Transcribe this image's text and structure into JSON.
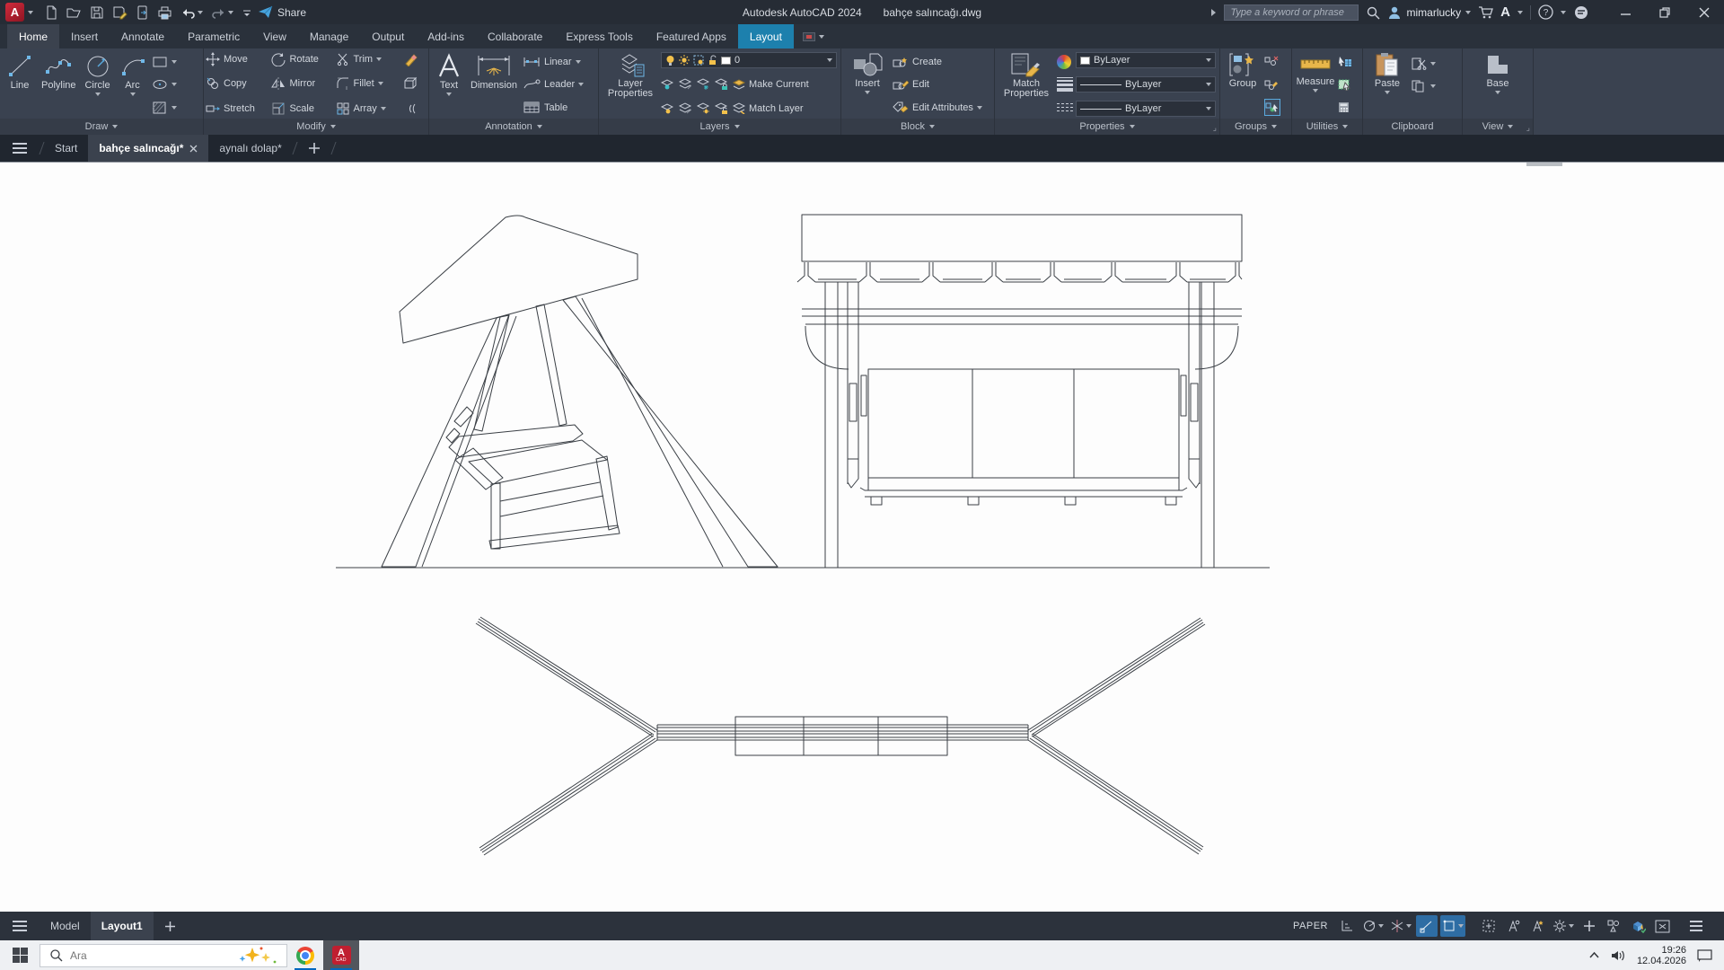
{
  "colors": {
    "layout_tab_blue": "#1d80ad",
    "snap_active_blue": "#2e6da4",
    "canvas_stroke": "#3a3f45",
    "accent_yellow": "#e9b23c",
    "accent_blue": "#5aa9dd"
  },
  "titlebar": {
    "app_badge": "A",
    "app_title": "Autodesk AutoCAD 2024",
    "doc_title": "bahçe salıncağı.dwg",
    "share_label": "Share",
    "search_placeholder": "Type a keyword or phrase",
    "user_name": "mimarlucky",
    "autodesk_logo": "A"
  },
  "ribbon": {
    "tabs": [
      "Home",
      "Insert",
      "Annotate",
      "Parametric",
      "View",
      "Manage",
      "Output",
      "Add-ins",
      "Collaborate",
      "Express Tools",
      "Featured Apps",
      "Layout"
    ],
    "panels": {
      "draw": {
        "title": "Draw",
        "line": "Line",
        "polyline": "Polyline",
        "circle": "Circle",
        "arc": "Arc"
      },
      "modify": {
        "title": "Modify",
        "move": "Move",
        "rotate": "Rotate",
        "trim": "Trim",
        "copy": "Copy",
        "mirror": "Mirror",
        "fillet": "Fillet",
        "stretch": "Stretch",
        "scale": "Scale",
        "array": "Array"
      },
      "annotation": {
        "title": "Annotation",
        "text": "Text",
        "dimension": "Dimension",
        "linear": "Linear",
        "leader": "Leader",
        "table": "Table"
      },
      "layers": {
        "title": "Layers",
        "layer_properties": "Layer Properties",
        "current_layer": "0",
        "make_current": "Make Current",
        "match_layer": "Match Layer"
      },
      "block": {
        "title": "Block",
        "insert": "Insert",
        "create": "Create",
        "edit": "Edit",
        "edit_attributes": "Edit Attributes"
      },
      "properties": {
        "title": "Properties",
        "match_properties": "Match Properties",
        "color_value": "ByLayer",
        "lineweight_value": "ByLayer",
        "linetype_value": "ByLayer"
      },
      "groups": {
        "title": "Groups",
        "group": "Group"
      },
      "utilities": {
        "title": "Utilities",
        "measure": "Measure"
      },
      "clipboard": {
        "title": "Clipboard",
        "paste": "Paste"
      },
      "view": {
        "title": "View",
        "base": "Base"
      }
    }
  },
  "file_tabs": {
    "start": "Start",
    "doc1": "bahçe salıncağı*",
    "doc2": "aynalı dolap*"
  },
  "status_bar": {
    "model_tab": "Model",
    "layout_tab": "Layout1",
    "space_mode": "PAPER"
  },
  "taskbar": {
    "search_placeholder": "Ara",
    "time": "19:26",
    "date": "12.04.2026",
    "autocad_badge": "A",
    "autocad_badge_sub": "CAD"
  }
}
